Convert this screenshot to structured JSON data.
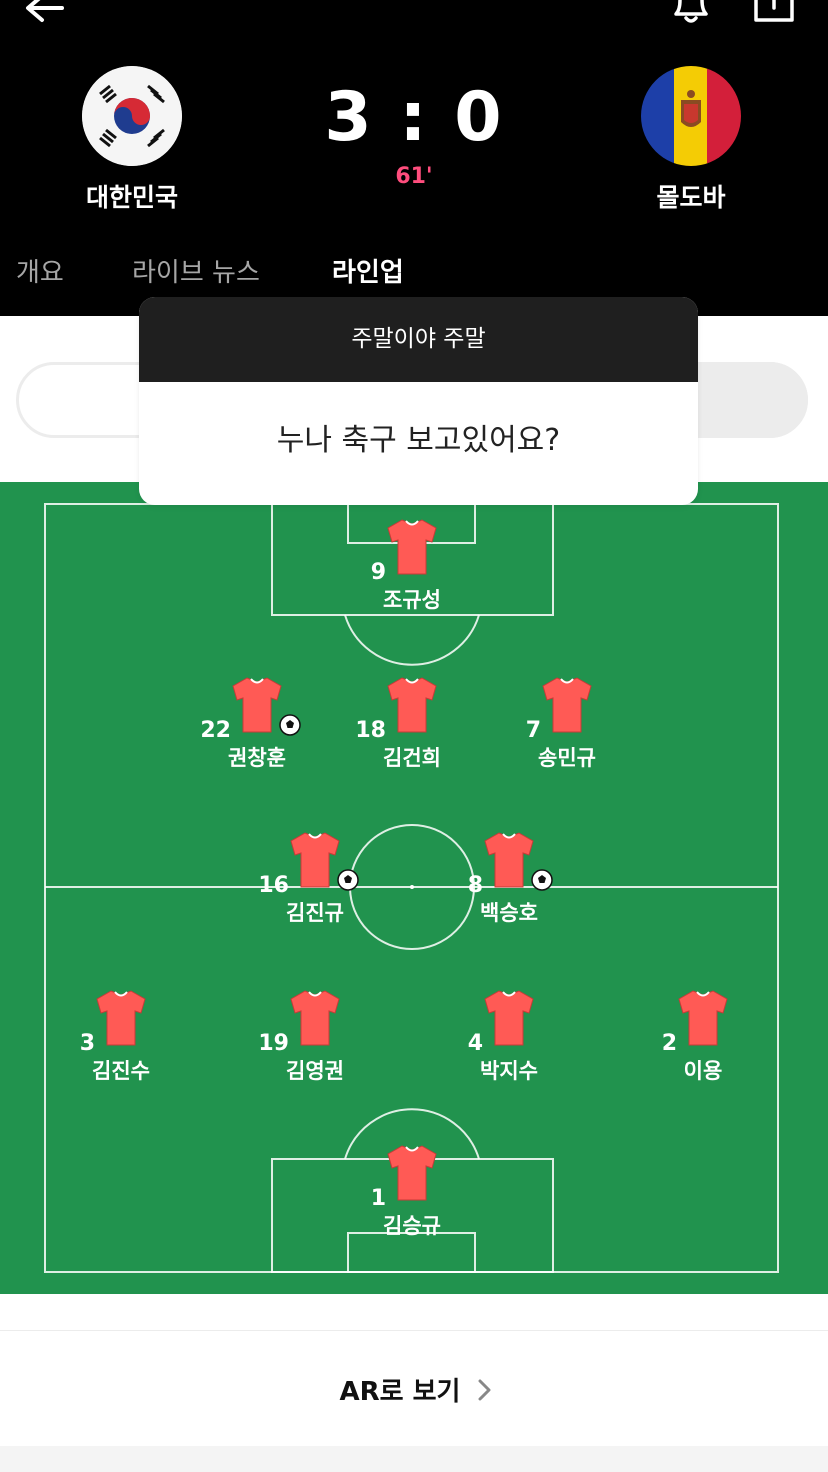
{
  "header": {
    "home_team": "대한민국",
    "away_team": "몰도바",
    "score": "3 : 0",
    "minute": "61'",
    "icons": {
      "back": "back-arrow-icon",
      "bell": "bell-icon",
      "share": "share-icon"
    }
  },
  "tabs": [
    {
      "label": "개요"
    },
    {
      "label": "라이브 뉴스"
    },
    {
      "label": "라인업"
    }
  ],
  "popup": {
    "title": "주말이야 주말",
    "message": "누나 축구 보고있어요?"
  },
  "lineup": {
    "players": [
      {
        "number": "9",
        "name": "조규성",
        "goal": false
      },
      {
        "number": "22",
        "name": "권창훈",
        "goal": true
      },
      {
        "number": "18",
        "name": "김건희",
        "goal": false
      },
      {
        "number": "7",
        "name": "송민규",
        "goal": false
      },
      {
        "number": "16",
        "name": "김진규",
        "goal": true
      },
      {
        "number": "8",
        "name": "백승호",
        "goal": true
      },
      {
        "number": "3",
        "name": "김진수",
        "goal": false
      },
      {
        "number": "19",
        "name": "김영권",
        "goal": false
      },
      {
        "number": "4",
        "name": "박지수",
        "goal": false
      },
      {
        "number": "2",
        "name": "이용",
        "goal": false
      },
      {
        "number": "1",
        "name": "김승규",
        "goal": false
      }
    ]
  },
  "ar_button": {
    "label": "AR로 보기"
  },
  "colors": {
    "pitch": "#21934e",
    "jersey": "#ff5a55",
    "minute": "#ff4d7d"
  }
}
